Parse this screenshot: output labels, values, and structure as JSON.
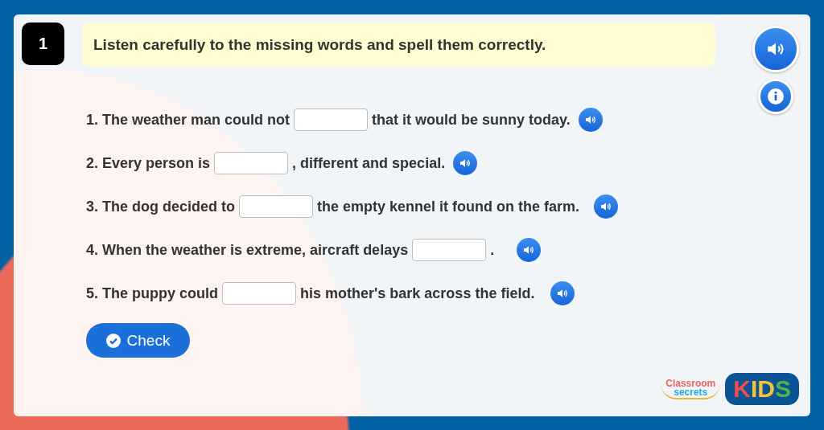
{
  "question": {
    "number": "1",
    "instruction": "Listen carefully to the missing words and spell them correctly."
  },
  "sentences": [
    {
      "before": "1. The weather man could not",
      "after": "that it would be sunny today."
    },
    {
      "before": "2. Every person is",
      "after": ", different and special."
    },
    {
      "before": "3. The dog decided to",
      "after": "the empty kennel it found on the farm."
    },
    {
      "before": "4. When the weather is extreme, aircraft delays",
      "after": "."
    },
    {
      "before": "5. The puppy could",
      "after": "his mother's bark across the field."
    }
  ],
  "check_button": {
    "label": "Check"
  },
  "logo": {
    "line_1": "Classroom",
    "line_2": "secrets",
    "badge": "KIDS"
  }
}
